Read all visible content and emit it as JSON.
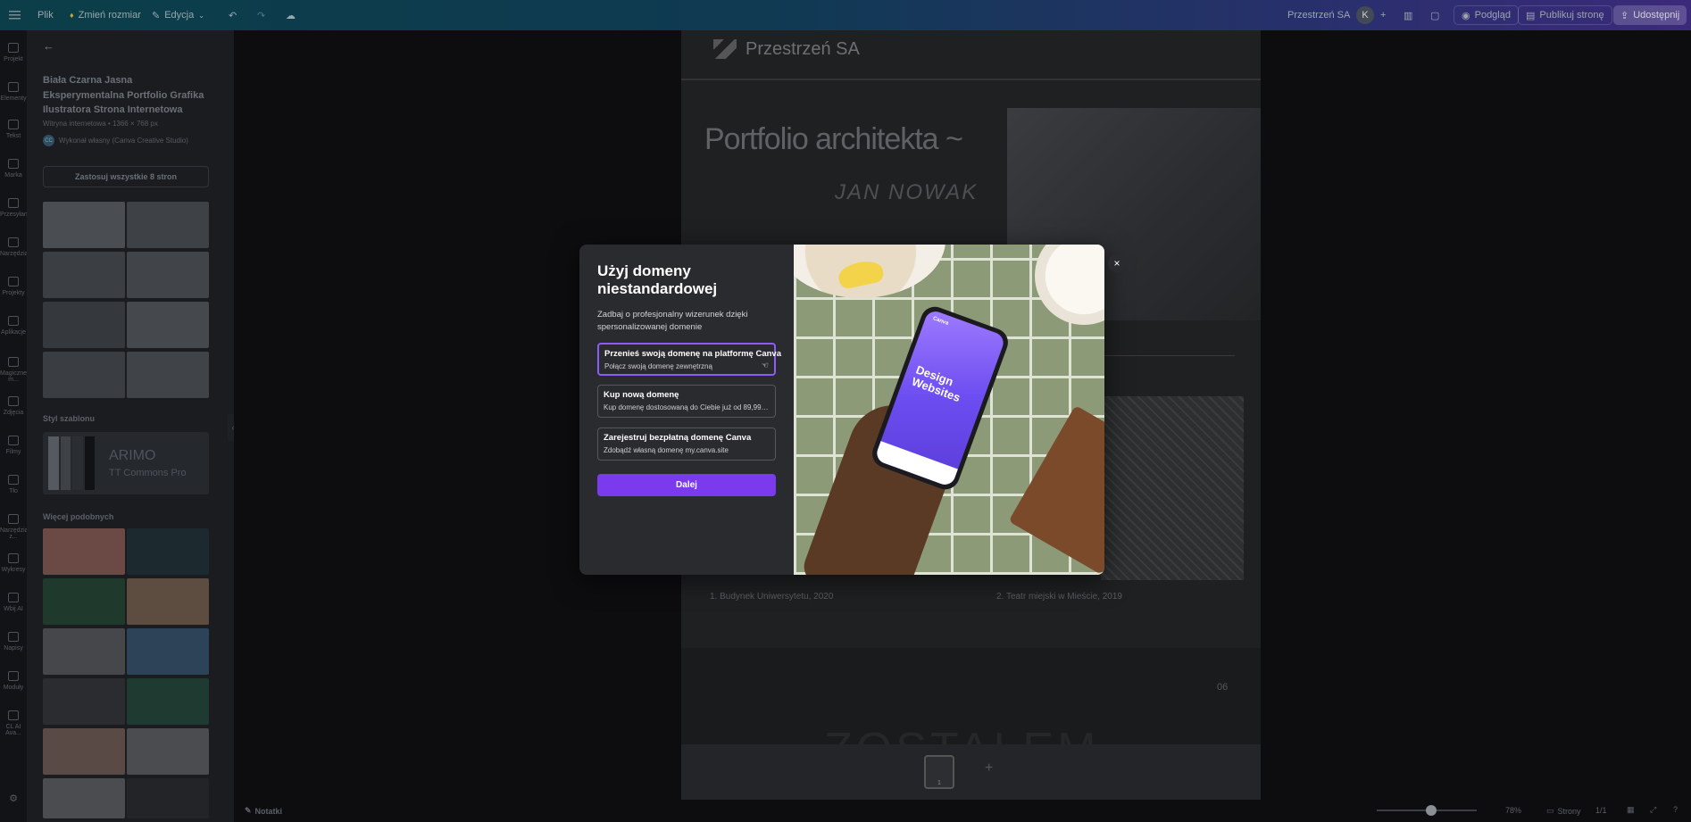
{
  "topbar": {
    "menu_icon": "hamburger-icon",
    "file": "Plik",
    "resize": "Zmień rozmiar",
    "edit": "Edycja",
    "workspace": "Przestrzeń SA",
    "avatar_initial": "K",
    "preview": "Podgląd",
    "publish": "Publikuj stronę",
    "share": "Udostępnij"
  },
  "rail": {
    "items": [
      "Projekt",
      "Elementy",
      "Tekst",
      "Marka",
      "Przesyłanie",
      "Narzędzia",
      "Projekty",
      "Aplikacje",
      "Magiczne m...",
      "Zdjęcia",
      "Filmy",
      "Tło",
      "Narzędzia z...",
      "Wykresy",
      "Wbij AI",
      "Napisy",
      "Moduły",
      "CL AI Ava..."
    ]
  },
  "panel": {
    "title": "Biała Czarna Jasna Eksperymentalna Portfolio Grafika Ilustratora Strona Internetowa",
    "subtitle": "Witryna internetowa • 1366 × 768 px",
    "author_badge": "CC",
    "author": "Wykonał własny (Canva Creative Studio)",
    "apply_all": "Zastosuj wszystkie 8 stron",
    "template_style": "Styl szablonu",
    "font_primary": "ARIMO",
    "font_secondary": "TT Commons Pro",
    "more_similar": "Więcej podobnych"
  },
  "page": {
    "brand": "Przestrzeń SA",
    "title": "Portfolio architekta ~",
    "name": "JAN NOWAK",
    "caption1": "1.        Budynek Uniwersytetu, 2020",
    "caption2": "2.        Teatr miejski w Mieście, 2019",
    "page_number": "06",
    "big_word": "ZOSTAŁEM"
  },
  "pages_strip": {
    "thumb_label": "1",
    "add_label": "+"
  },
  "bottombar": {
    "notes": "Notatki",
    "zoom": 0.78,
    "zoom_label": "78%",
    "pages": "Strony",
    "page_count": "1/1"
  },
  "modal": {
    "title": "Użyj domeny niestandardowej",
    "description": "Zadbaj o profesjonalny wizerunek dzięki spersonalizowanej domenie",
    "options": [
      {
        "title": "Przenieś swoją domenę na platformę Canva",
        "subtitle": "Połącz swoją domenę zewnętrzną",
        "selected": true
      },
      {
        "title": "Kup nową domenę",
        "subtitle": "Kup domenę dostosowaną do Ciebie już od 89,99 z...",
        "selected": false
      },
      {
        "title": "Zarejestruj bezpłatną domenę Canva",
        "subtitle": "Zdobądź własną domenę my.canva.site",
        "selected": false
      }
    ],
    "next": "Dalej",
    "close": "×",
    "phone_brand": "Canva",
    "phone_text": "Design Websites"
  },
  "colors": {
    "accent": "#7c3aed",
    "selected_border": "#8b5cf6"
  }
}
